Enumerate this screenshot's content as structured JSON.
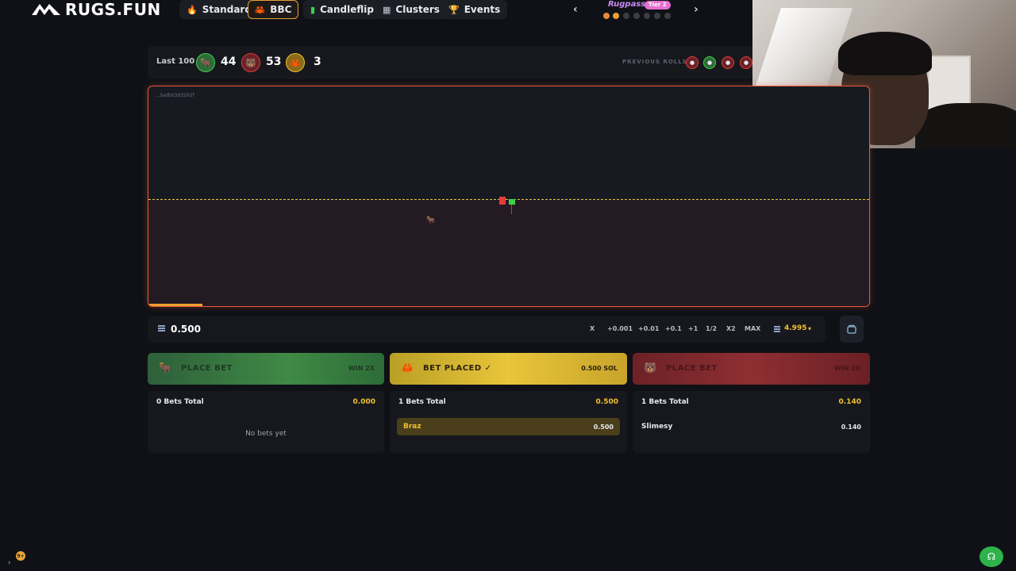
{
  "brand": {
    "logo_text": "RUGS.FUN"
  },
  "nav": {
    "tabs": [
      {
        "label": "Standard",
        "icon": "flame-icon"
      },
      {
        "label": "BBC",
        "icon": "crab-icon",
        "active": true
      },
      {
        "label": "Candleflip",
        "icon": "candle-icon"
      },
      {
        "label": "Clusters",
        "icon": "grid-icon"
      },
      {
        "label": "Events",
        "icon": "trophy-icon"
      }
    ],
    "rugpass": {
      "label": "Rugpass",
      "tier": "Tier 2"
    }
  },
  "stats": {
    "label": "Last 100",
    "bull_count": "44",
    "bear_count": "53",
    "crab_count": "3",
    "previous_label": "PREVIOUS ROLLS"
  },
  "chart": {
    "hash": "...3adb03d3292f"
  },
  "bet_amount": {
    "value": "0.500",
    "buttons": [
      "X",
      "+0.001",
      "+0.01",
      "+0.1",
      "+1",
      "1/2",
      "X2",
      "MAX"
    ],
    "balance": "4.995"
  },
  "bets": {
    "bull": {
      "button_label": "PLACE BET",
      "multiplier": "WIN 2X",
      "total_label": "0 Bets Total",
      "total_amount": "0.000",
      "empty_text": "No bets yet"
    },
    "crab": {
      "button_label": "BET PLACED ✓",
      "amount": "0.500 SOL",
      "total_label": "1 Bets Total",
      "total_amount": "0.500",
      "rows": [
        {
          "name": "Braz",
          "value": "0.500"
        }
      ]
    },
    "bear": {
      "button_label": "PLACE BET",
      "multiplier": "WIN 2X",
      "total_label": "1 Bets Total",
      "total_amount": "0.140",
      "rows": [
        {
          "name": "Slimesy",
          "value": "0.140"
        }
      ]
    }
  },
  "footer": {
    "level": "9+"
  },
  "colors": {
    "bull": "#3f8a45",
    "crab": "#e8c53a",
    "bear": "#8e2e32",
    "accent": "#f0a030",
    "gold": "#f0c030"
  }
}
